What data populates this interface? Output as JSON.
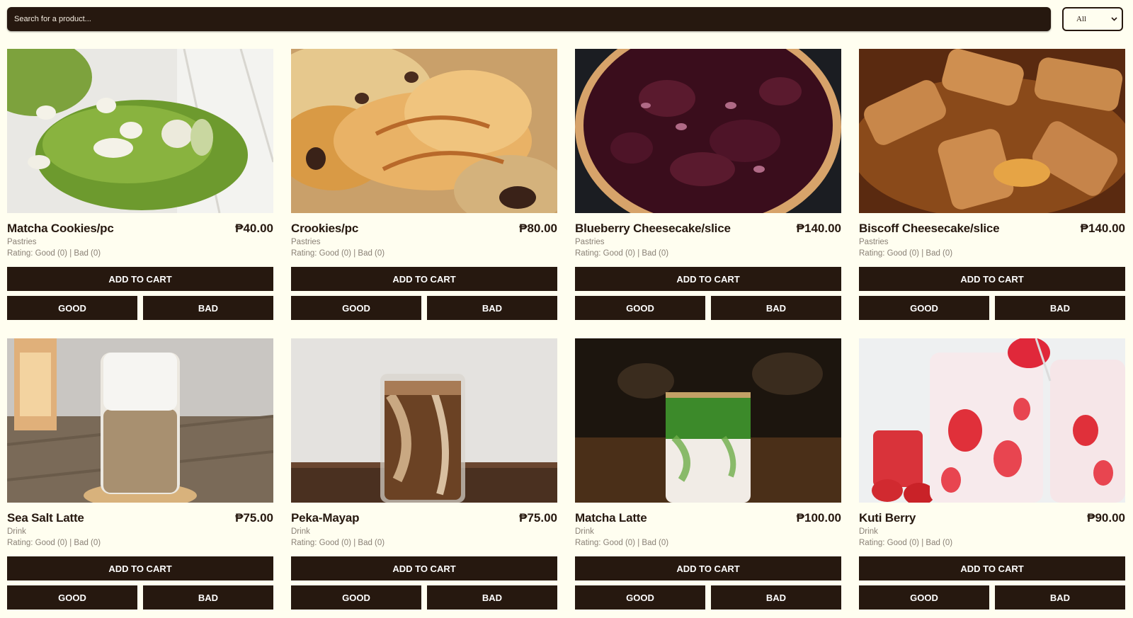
{
  "search": {
    "placeholder": "Search for a product..."
  },
  "filter": {
    "selected": "All"
  },
  "labels": {
    "add_to_cart": "ADD TO CART",
    "good": "GOOD",
    "bad": "BAD"
  },
  "products": [
    {
      "name": "Matcha Cookies/pc",
      "price": "₱40.00",
      "category": "Pastries",
      "rating": "Rating: Good (0) | Bad (0)",
      "image": "matcha-cookie-image"
    },
    {
      "name": "Crookies/pc",
      "price": "₱80.00",
      "category": "Pastries",
      "rating": "Rating: Good (0) | Bad (0)",
      "image": "crookie-image"
    },
    {
      "name": "Blueberry Cheesecake/slice",
      "price": "₱140.00",
      "category": "Pastries",
      "rating": "Rating: Good (0) | Bad (0)",
      "image": "blueberry-cheesecake-image"
    },
    {
      "name": "Biscoff Cheesecake/slice",
      "price": "₱140.00",
      "category": "Pastries",
      "rating": "Rating: Good (0) | Bad (0)",
      "image": "biscoff-cheesecake-image"
    },
    {
      "name": "Sea Salt Latte",
      "price": "₱75.00",
      "category": "Drink",
      "rating": "Rating: Good (0) | Bad (0)",
      "image": "sea-salt-latte-image"
    },
    {
      "name": "Peka-Mayap",
      "price": "₱75.00",
      "category": "Drink",
      "rating": "Rating: Good (0) | Bad (0)",
      "image": "peka-mayap-image"
    },
    {
      "name": "Matcha Latte",
      "price": "₱100.00",
      "category": "Drink",
      "rating": "Rating: Good (0) | Bad (0)",
      "image": "matcha-latte-image"
    },
    {
      "name": "Kuti Berry",
      "price": "₱90.00",
      "category": "Drink",
      "rating": "Rating: Good (0) | Bad (0)",
      "image": "kuti-berry-image"
    }
  ],
  "colors": {
    "background": "#fffef0",
    "primary": "#26180f",
    "muted_text": "#8a8176"
  }
}
